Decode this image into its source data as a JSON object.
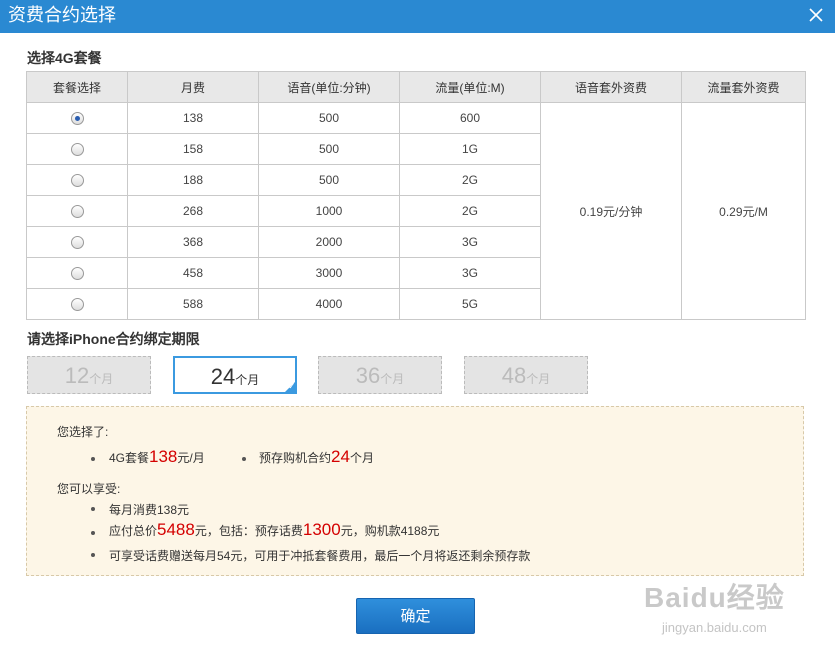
{
  "dialog": {
    "title": "资费合约选择"
  },
  "plan_section": {
    "title": "选择4G套餐"
  },
  "table": {
    "headers": [
      "套餐选择",
      "月费",
      "语音(单位:分钟)",
      "流量(单位:M)",
      "语音套外资费",
      "流量套外资费"
    ],
    "rows": [
      {
        "selected": true,
        "fee": "138",
        "voice": "500",
        "data": "600"
      },
      {
        "selected": false,
        "fee": "158",
        "voice": "500",
        "data": "1G"
      },
      {
        "selected": false,
        "fee": "188",
        "voice": "500",
        "data": "2G"
      },
      {
        "selected": false,
        "fee": "268",
        "voice": "1000",
        "data": "2G"
      },
      {
        "selected": false,
        "fee": "368",
        "voice": "2000",
        "data": "3G"
      },
      {
        "selected": false,
        "fee": "458",
        "voice": "3000",
        "data": "3G"
      },
      {
        "selected": false,
        "fee": "588",
        "voice": "4000",
        "data": "5G"
      }
    ],
    "voice_extra": "0.19元/分钟",
    "data_extra": "0.29元/M"
  },
  "term_section": {
    "title": "请选择iPhone合约绑定期限"
  },
  "terms": [
    {
      "num": "12",
      "unit": "个月",
      "active": false
    },
    {
      "num": "24",
      "unit": "个月",
      "active": true
    },
    {
      "num": "36",
      "unit": "个月",
      "active": false
    },
    {
      "num": "48",
      "unit": "个月",
      "active": false
    }
  ],
  "summary": {
    "chosen_heading": "您选择了:",
    "plan_prefix": "4G套餐",
    "plan_value": "138",
    "plan_suffix": "元/月",
    "contract_prefix": "预存购机合约",
    "contract_value": "24",
    "contract_suffix": "个月",
    "benefit_heading": "您可以享受:",
    "monthly": "每月消费138元",
    "total_prefix": "应付总价",
    "total_value": "5488",
    "total_mid": "元，包括：预存话费",
    "prepay_value": "1300",
    "total_suffix": "元，购机款4188元",
    "gift": "可享受话费赠送每月54元，可用于冲抵套餐费用，最后一个月将返还剩余预存款"
  },
  "buttons": {
    "confirm": "确定"
  },
  "watermark": {
    "logo": "Baidu经验",
    "url": "jingyan.baidu.com"
  },
  "colors": {
    "titlebar": "#2a89d2",
    "accent": "#3b9ae0",
    "highlight": "#d40000",
    "summary_bg": "#fdf6e7"
  }
}
